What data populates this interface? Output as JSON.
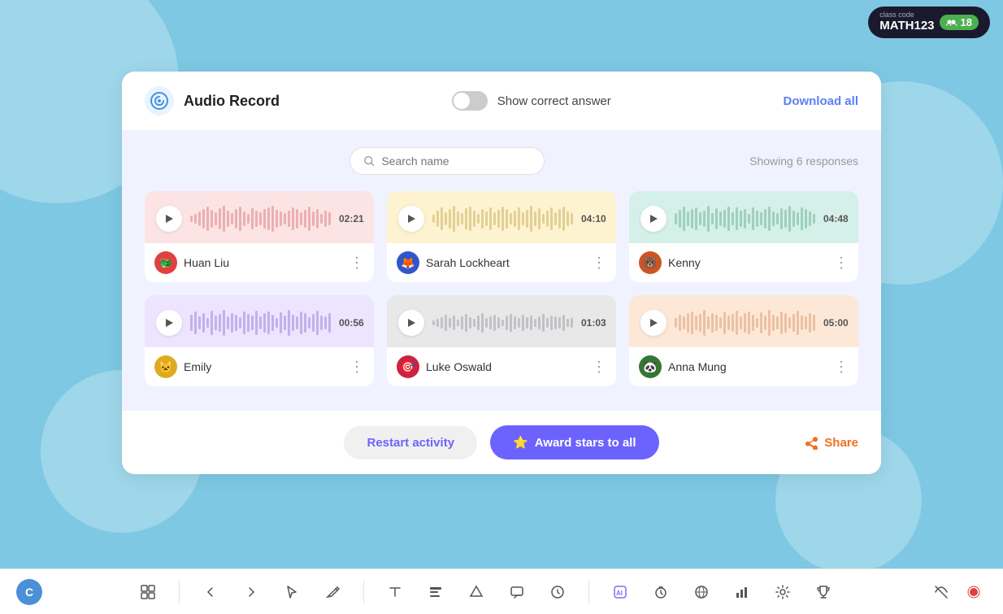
{
  "topbar": {
    "class_code_label": "class code",
    "class_code": "MATH123",
    "students_count": "18"
  },
  "header": {
    "title": "Audio Record",
    "show_correct_label": "Show correct answer",
    "download_all": "Download all",
    "toggle_active": false
  },
  "search": {
    "placeholder": "Search name",
    "showing_text": "Showing 6 responses"
  },
  "cards": [
    {
      "id": "c1",
      "color_class": "color-pink",
      "duration": "02:21",
      "student_name": "Huan Liu",
      "avatar_bg": "#e04040",
      "avatar_emoji": "🐲"
    },
    {
      "id": "c2",
      "color_class": "color-yellow",
      "duration": "04:10",
      "student_name": "Sarah Lockheart",
      "avatar_bg": "#3355cc",
      "avatar_emoji": "🦊"
    },
    {
      "id": "c3",
      "color_class": "color-green",
      "duration": "04:48",
      "student_name": "Kenny",
      "avatar_bg": "#cc5522",
      "avatar_emoji": "🐻"
    },
    {
      "id": "c4",
      "color_class": "color-purple",
      "duration": "00:56",
      "student_name": "Emily",
      "avatar_bg": "#ddaa22",
      "avatar_emoji": "🐱"
    },
    {
      "id": "c5",
      "color_class": "color-gray",
      "duration": "01:03",
      "student_name": "Luke Oswald",
      "avatar_bg": "#cc2244",
      "avatar_emoji": "🎯"
    },
    {
      "id": "c6",
      "color_class": "color-peach",
      "duration": "05:00",
      "student_name": "Anna Mung",
      "avatar_bg": "#337733",
      "avatar_emoji": "🐼"
    }
  ],
  "footer": {
    "restart_label": "Restart activity",
    "award_label": "Award stars to all",
    "share_label": "Share"
  }
}
